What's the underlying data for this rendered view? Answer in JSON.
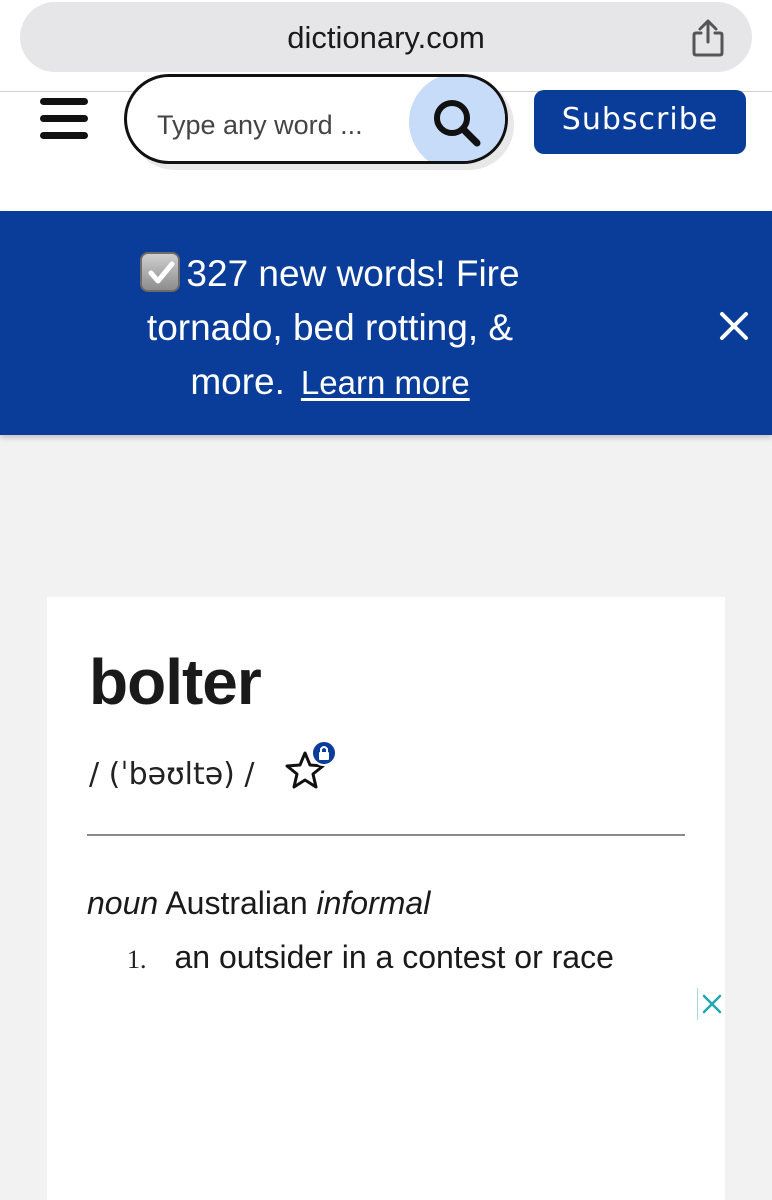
{
  "browser": {
    "url": "dictionary.com",
    "share_icon": "share-icon"
  },
  "header": {
    "menu_icon": "hamburger-icon",
    "search": {
      "placeholder": "Type any word ..."
    },
    "search_icon": "search-icon",
    "subscribe_label": "Subscribe"
  },
  "banner": {
    "check_icon": "checkbox-icon",
    "text": "327 new words! Fire tornado, bed rotting, & more.",
    "link_label": "Learn more",
    "close_icon": "close-icon"
  },
  "entry": {
    "headword": "bolter",
    "pronunciation": "/ (ˈbəʊltə) /",
    "favorite_icon": "star-lock-icon",
    "part_of_speech": "noun",
    "region": "Australian",
    "register": "informal",
    "definitions": [
      {
        "number": "1.",
        "text": "an outsider in a contest or race"
      }
    ]
  },
  "ad": {
    "close_icon": "ad-close-icon"
  },
  "colors": {
    "brand_blue": "#0a3d9a",
    "search_button": "#c6dcf9",
    "page_bg": "#f2f2f2"
  }
}
